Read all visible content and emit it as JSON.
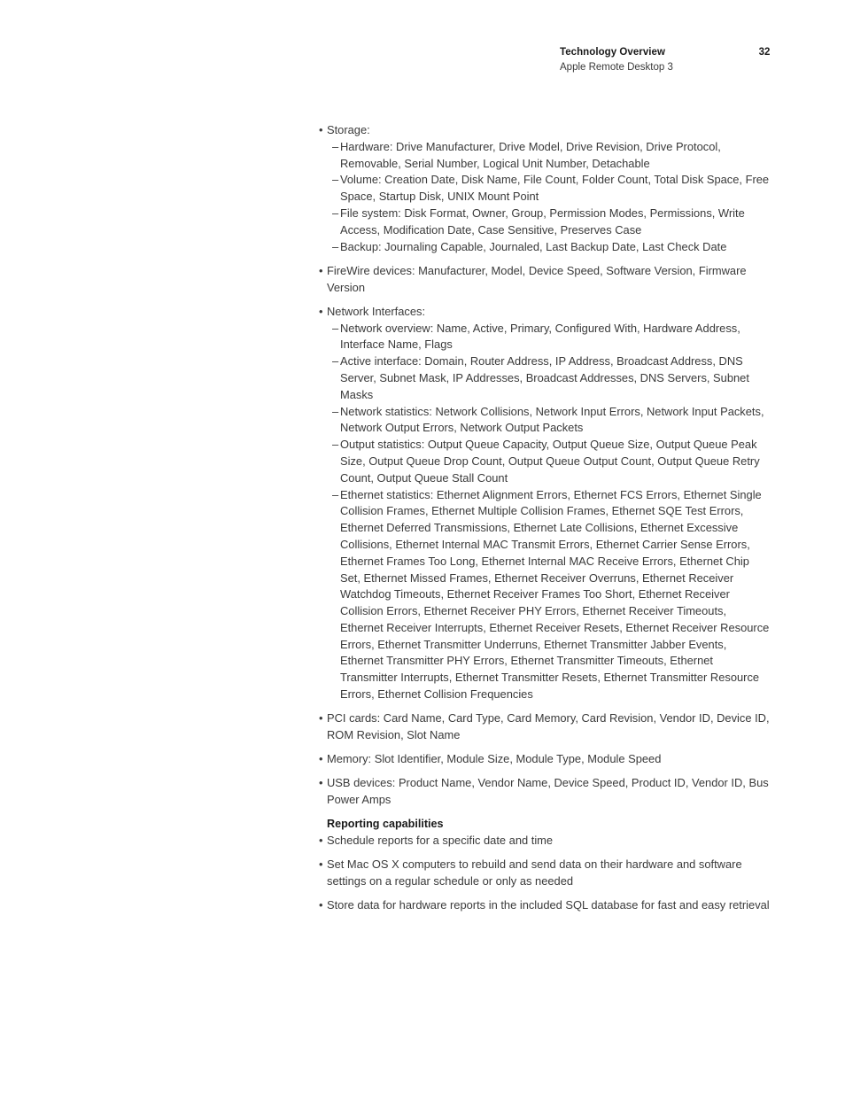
{
  "header": {
    "title": "Technology Overview",
    "subtitle": "Apple Remote Desktop 3",
    "page_number": "32"
  },
  "markers": {
    "bullet": "•",
    "dash": "–"
  },
  "body": {
    "storage": {
      "label": "Storage:",
      "items": [
        "Hardware: Drive Manufacturer, Drive Model, Drive Revision, Drive Protocol, Removable, Serial Number, Logical Unit Number, Detachable",
        "Volume: Creation Date, Disk Name, File Count, Folder Count, Total Disk Space, Free Space, Startup Disk, UNIX Mount Point",
        "File system: Disk Format, Owner, Group, Permission Modes, Permissions, Write Access, Modification Date, Case Sensitive, Preserves Case",
        "Backup: Journaling Capable, Journaled, Last Backup Date, Last Check Date"
      ]
    },
    "firewire": {
      "label": "FireWire devices: Manufacturer, Model, Device Speed, Software Version, Firmware Version"
    },
    "network": {
      "label": "Network Interfaces:",
      "items": [
        "Network overview: Name, Active, Primary, Configured With, Hardware Address, Interface Name, Flags",
        "Active interface: Domain, Router Address, IP Address, Broadcast Address, DNS Server, Subnet Mask, IP Addresses, Broadcast Addresses, DNS Servers, Subnet Masks",
        "Network statistics: Network Collisions, Network Input Errors, Network Input Packets, Network Output Errors, Network Output Packets",
        "Output statistics: Output Queue Capacity, Output Queue Size, Output Queue Peak Size, Output Queue Drop Count, Output Queue Output Count, Output Queue Retry Count, Output Queue Stall Count",
        "Ethernet statistics: Ethernet Alignment Errors, Ethernet FCS Errors, Ethernet Single Collision Frames, Ethernet Multiple Collision Frames, Ethernet SQE Test Errors, Ethernet Deferred Transmissions, Ethernet Late Collisions, Ethernet Excessive Collisions, Ethernet Internal MAC Transmit Errors, Ethernet Carrier Sense Errors, Ethernet Frames Too Long, Ethernet Internal MAC Receive Errors, Ethernet Chip Set, Ethernet Missed Frames, Ethernet Receiver Overruns, Ethernet Receiver Watchdog Timeouts, Ethernet Receiver Frames Too Short, Ethernet Receiver Collision Errors, Ethernet Receiver PHY Errors, Ethernet Receiver Timeouts, Ethernet Receiver Interrupts, Ethernet Receiver Resets, Ethernet Receiver Resource Errors, Ethernet Transmitter Underruns, Ethernet Transmitter Jabber Events, Ethernet Transmitter PHY Errors, Ethernet Transmitter Timeouts, Ethernet Transmitter Interrupts, Ethernet Transmitter Resets, Ethernet Transmitter Resource Errors, Ethernet Collision Frequencies"
      ]
    },
    "pci_cards": "PCI cards: Card Name, Card Type, Card Memory, Card Revision, Vendor ID, Device ID, ROM Revision, Slot Name",
    "memory": "Memory: Slot Identifier, Module Size, Module Type, Module Speed",
    "usb_devices": "USB devices: Product Name, Vendor Name, Device Speed, Product ID, Vendor ID, Bus Power Amps",
    "reporting": {
      "heading": "Reporting capabilities",
      "items": [
        "Schedule reports for a specific date and time",
        "Set Mac OS X computers to rebuild and send data on their hardware and software settings on a regular schedule or only as needed",
        "Store data for hardware reports in the included SQL database for fast and easy retrieval"
      ]
    }
  }
}
